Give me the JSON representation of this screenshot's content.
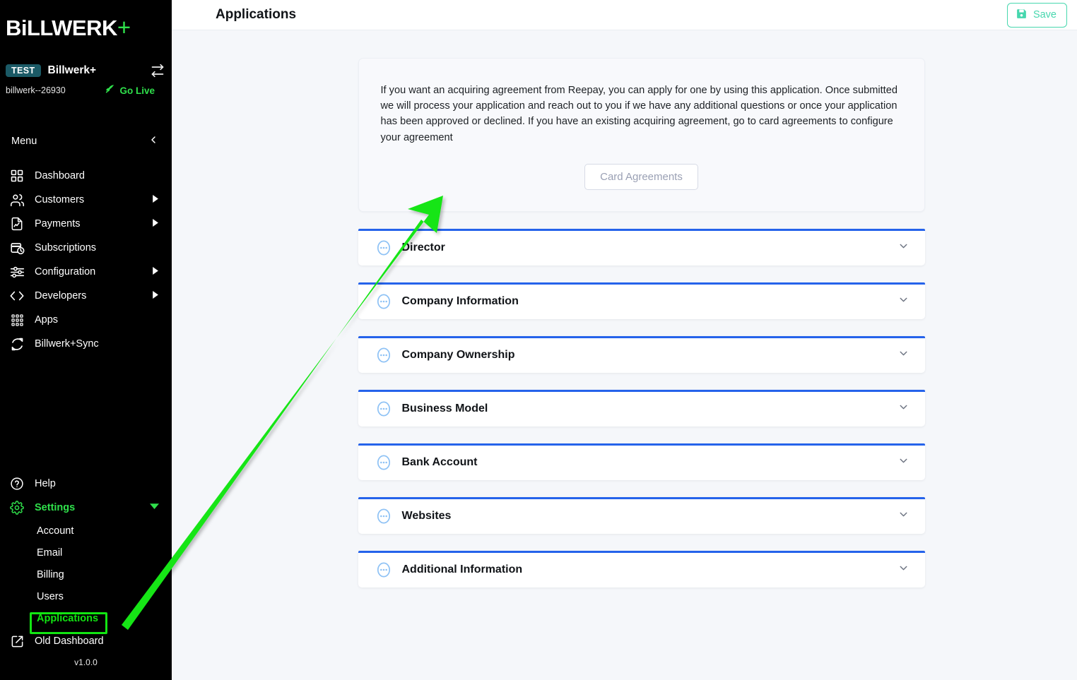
{
  "sidebar": {
    "logo": {
      "text_main": "BiLLWERK",
      "plus": "+"
    },
    "account": {
      "badge": "TEST",
      "name": "Billwerk+",
      "id": "billwerk--26930",
      "go_live": "Go Live",
      "swap_icon": "swap-horizontal-icon"
    },
    "menu_label": "Menu",
    "collapse_icon": "chevron-left-icon",
    "items": [
      {
        "label": "Dashboard",
        "icon": "grid-icon",
        "has_caret": false
      },
      {
        "label": "Customers",
        "icon": "users-icon",
        "has_caret": true
      },
      {
        "label": "Payments",
        "icon": "document-icon",
        "has_caret": true
      },
      {
        "label": "Subscriptions",
        "icon": "calendar-clock-icon",
        "has_caret": false
      },
      {
        "label": "Configuration",
        "icon": "sliders-icon",
        "has_caret": true
      },
      {
        "label": "Developers",
        "icon": "code-icon",
        "has_caret": true
      },
      {
        "label": "Apps",
        "icon": "apps-grid-icon",
        "has_caret": false
      },
      {
        "label": "Billwerk+Sync",
        "icon": "sync-icon",
        "has_caret": false
      }
    ],
    "bottom_items": [
      {
        "label": "Help",
        "icon": "help-circle-icon",
        "has_caret": false
      },
      {
        "label": "Settings",
        "icon": "gear-icon",
        "has_caret": true
      }
    ],
    "settings_sub_items": [
      {
        "label": "Account",
        "active": false
      },
      {
        "label": "Email",
        "active": false
      },
      {
        "label": "Billing",
        "active": false
      },
      {
        "label": "Users",
        "active": false
      },
      {
        "label": "Applications",
        "active": true
      }
    ],
    "old_dashboard": {
      "label": "Old Dashboard",
      "icon": "external-link-icon"
    },
    "version": "v1.0.0"
  },
  "topbar": {
    "title": "Applications",
    "save_label": "Save",
    "save_icon": "save-disk-icon"
  },
  "info_card": {
    "text": "If you want an acquiring agreement from Reepay, you can apply for one by using this application. Once submitted we will process your application and reach out to you if we have any additional questions or once your application has been approved or declined. If you have an existing acquiring agreement, go to card agreements to configure your agreement",
    "button_label": "Card Agreements"
  },
  "sections": [
    {
      "title": "Director",
      "icon": "dots-circle-icon",
      "chevron": "chevron-down-icon",
      "expanded": false
    },
    {
      "title": "Company Information",
      "icon": "dots-circle-icon",
      "chevron": "chevron-down-icon",
      "expanded": false
    },
    {
      "title": "Company Ownership",
      "icon": "dots-circle-icon",
      "chevron": "chevron-down-icon",
      "expanded": false
    },
    {
      "title": "Business Model",
      "icon": "dots-circle-icon",
      "chevron": "chevron-down-icon",
      "expanded": false
    },
    {
      "title": "Bank Account",
      "icon": "dots-circle-icon",
      "chevron": "chevron-down-icon",
      "expanded": false
    },
    {
      "title": "Websites",
      "icon": "dots-circle-icon",
      "chevron": "chevron-down-icon",
      "expanded": false
    },
    {
      "title": "Additional Information",
      "icon": "dots-circle-icon",
      "chevron": "chevron-down-icon",
      "expanded": false
    }
  ],
  "annotation": {
    "arrow_color": "#12e512",
    "highlight_color": "#12e512",
    "highlight_target": "Applications"
  },
  "colors": {
    "sidebar_bg": "#000000",
    "accent_green": "#2fe04b",
    "accent_blue": "#2563eb",
    "save_teal": "#47d7ae",
    "badge_teal": "#1b5a66",
    "page_bg": "#f5f7fa"
  }
}
